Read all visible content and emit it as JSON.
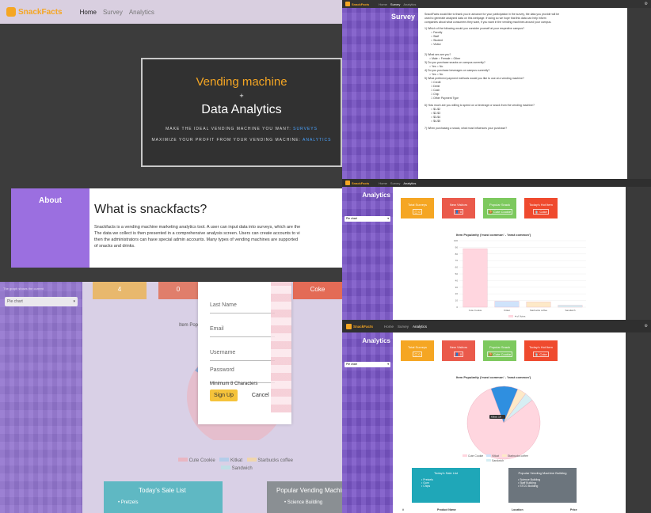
{
  "brand": {
    "name": "SnackFacts",
    "accent": "#f5a623",
    "purple": "#7a55c7"
  },
  "nav": {
    "home": "Home",
    "survey": "Survey",
    "analytics": "Analytics"
  },
  "hero": {
    "title_line1": "Vending machine",
    "plus": "+",
    "title_line2": "Data Analytics",
    "tag1_prefix": "MAKE THE IDEAL VENDING MACHINE YOU WANT:",
    "tag1_link": "SURVEYS",
    "tag2_prefix": "MAXIMIZE YOUR PROFIT FROM YOUR VENDING MACHINE:",
    "tag2_link": "ANALYTICS"
  },
  "about": {
    "label": "About",
    "heading": "What is snackfacts?",
    "lines": [
      "Snackfacts is a vending machine marketing analytics tool. A user can input data into surveys, which are the",
      "The data we collect is then presented in a comprehensive analysis screen. Users can create accounts to vi",
      "then the administrators can have special admin accounts. Many types of vending machines are supported",
      "of snacks and drinks."
    ]
  },
  "survey": {
    "side_title": "Survey",
    "intro": [
      "SnackFacts would like to thank you in advance for your participation in the survey, the data you provide will be",
      "used to generate analyzed data on this webpage. If doing so we hope that this data can help inform",
      "companies about what consumers they want, if you want in the vending machines around your campus."
    ],
    "q1": "1) Which of the following would you consider yourself at your respective campus?",
    "q1_opts": [
      "Faculty",
      "Staff",
      "Student",
      "Visitor"
    ],
    "q2": "2) What sex are you?",
    "q2_opts": [
      "Male",
      "Female",
      "Other"
    ],
    "q3": "3) Do you purchase snacks on campus currently?",
    "q3_opts": [
      "Yes",
      "No"
    ],
    "q4": "4) Do you purchase beverages on campus currently?",
    "q4_opts": [
      "Yes",
      "No"
    ],
    "q5": "5) What preferred payment methods would you like to use at a vending machine?",
    "q5_opts": [
      "Credit",
      "Debit",
      "Cash",
      "Chip",
      "Other Payment Type"
    ],
    "q6": "6) How much are you willing to spend on a beverage or snack from the vending machine?",
    "q6_opts": [
      "$1-$2",
      "$2-$3",
      "$3-$4",
      "$4-$5"
    ],
    "q7": "7) When purchasing a snack, what most influences your purchase?"
  },
  "analytics": {
    "side_title": "Analytics",
    "select": "Pie chart",
    "cards": {
      "total_surveys": "Total Surveys",
      "total_surveys_val": "0",
      "new_visitors": "New Visitors",
      "new_visitors_val": "0",
      "popular_snack": "Popular Snack",
      "popular_snack_val": "Cute Cookie",
      "todays_hot": "Today's Hot Item",
      "todays_hot_val": "Coke"
    },
    "chart_title": "Item Popularity ('most common' - 'least common')",
    "ylabel": "# of Votes",
    "pie_callout": "Kitkat: 18",
    "sale_list": {
      "title": "Today's Sale List",
      "items": [
        "Pretzels",
        "Gum",
        "Chips"
      ]
    },
    "popular_building": {
      "title": "Popular Vending Machine Building",
      "items": [
        "Science Building",
        "Staff Building",
        "STCG Building"
      ]
    },
    "table_headers": [
      "#",
      "Product Name",
      "Location",
      "Price"
    ]
  },
  "bg_panel": {
    "val_a": "4",
    "val_b": "0",
    "val_c": "Coke",
    "select": "Pie chart",
    "side_text": "The graph shows the current",
    "title": "Item Popularity ('most common' - 'least common')"
  },
  "signup": {
    "last_name": "Last Name",
    "email": "Email",
    "username": "Username",
    "password": "Password",
    "password_hint": "Minimum 8 Characters",
    "signup_btn": "Sign Up",
    "cancel_btn": "Cancel"
  },
  "chart_data": {
    "type": "bar",
    "categories": [
      "Cute Cookie",
      "Kitkat",
      "Starbucks coffee",
      "Sandwich"
    ],
    "series": [
      {
        "name": "# of Votes",
        "values": [
          88,
          9,
          8,
          3
        ]
      }
    ],
    "ylim": [
      0,
      100
    ],
    "colors": [
      "#ffd6df",
      "#cfe3fb",
      "#fde9c8",
      "#d6eef3"
    ],
    "pie_values": [
      80,
      12,
      4,
      4
    ],
    "legend": [
      "Cute Cookie",
      "Kitkat",
      "Starbucks coffee",
      "Sandwich"
    ]
  }
}
